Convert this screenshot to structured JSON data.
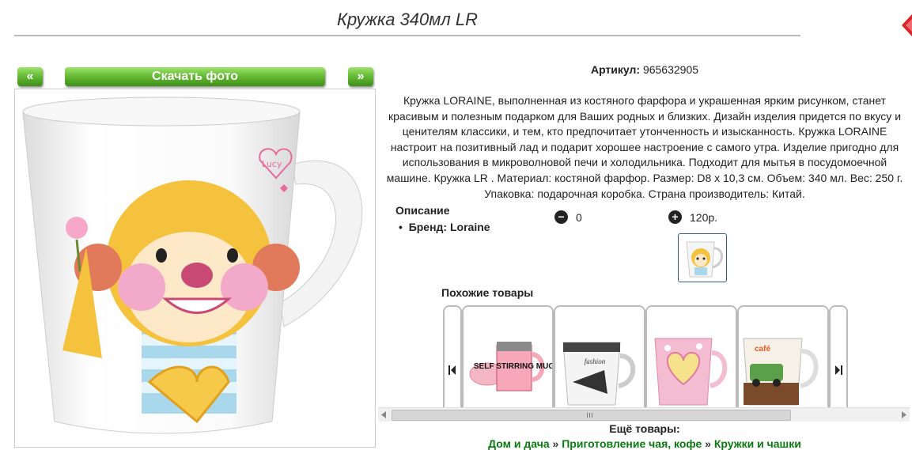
{
  "product": {
    "title": "Кружка 340мл LR",
    "article_label": "Артикул:",
    "article_value": "965632905",
    "description": "Кружка LORAINE, выполненная из костяного фарфора и украшенная ярким рисунком, станет красивым и полезным подарком для Ваших родных и близких. Дизайн изделия придется по вкусу и ценителям классики, и тем, кто предпочитает утонченность и изысканность. Кружка LORAINE настроит на позитивный лад и подарит хорошее настроение с самого утра. Изделие пригодно для использования в микроволновой печи и холодильника. Подходит для мытья в посудомоечной машине. Кружка LR . Материал: костяной фарфор. Размер: D8 x 10,3 см. Объем: 340 мл. Вес: 250 г. Упаковка: подарочная коробка. Страна производитель: Китай.",
    "specs_title": "Описание",
    "brand_label": "Бренд:",
    "brand_value": "Loraine",
    "minus_glyph": "−",
    "minus_value": "0",
    "plus_glyph": "+",
    "plus_value": "120р.",
    "mug_text": "Lucy"
  },
  "photo_nav": {
    "prev": "«",
    "download": "Скачать фото",
    "next": "»"
  },
  "similar": {
    "title": "Похожие товары",
    "items": [
      {
        "kind": "self-stirring-mug",
        "label": "SELF STIRRING MUG"
      },
      {
        "kind": "fashion-mug",
        "label": "fashion"
      },
      {
        "kind": "heart-pink-mug"
      },
      {
        "kind": "cafe-car-mug",
        "label": "café"
      }
    ]
  },
  "footer": {
    "more_title": "Ещё товары:",
    "crumbs": [
      "Дом и дача",
      "Приготовление чая, кофе",
      "Кружки и чашки"
    ],
    "separator": "»"
  },
  "colors": {
    "green_button": "#5fb32f",
    "link_green": "#0a7a10",
    "close_red": "#d8242a"
  }
}
